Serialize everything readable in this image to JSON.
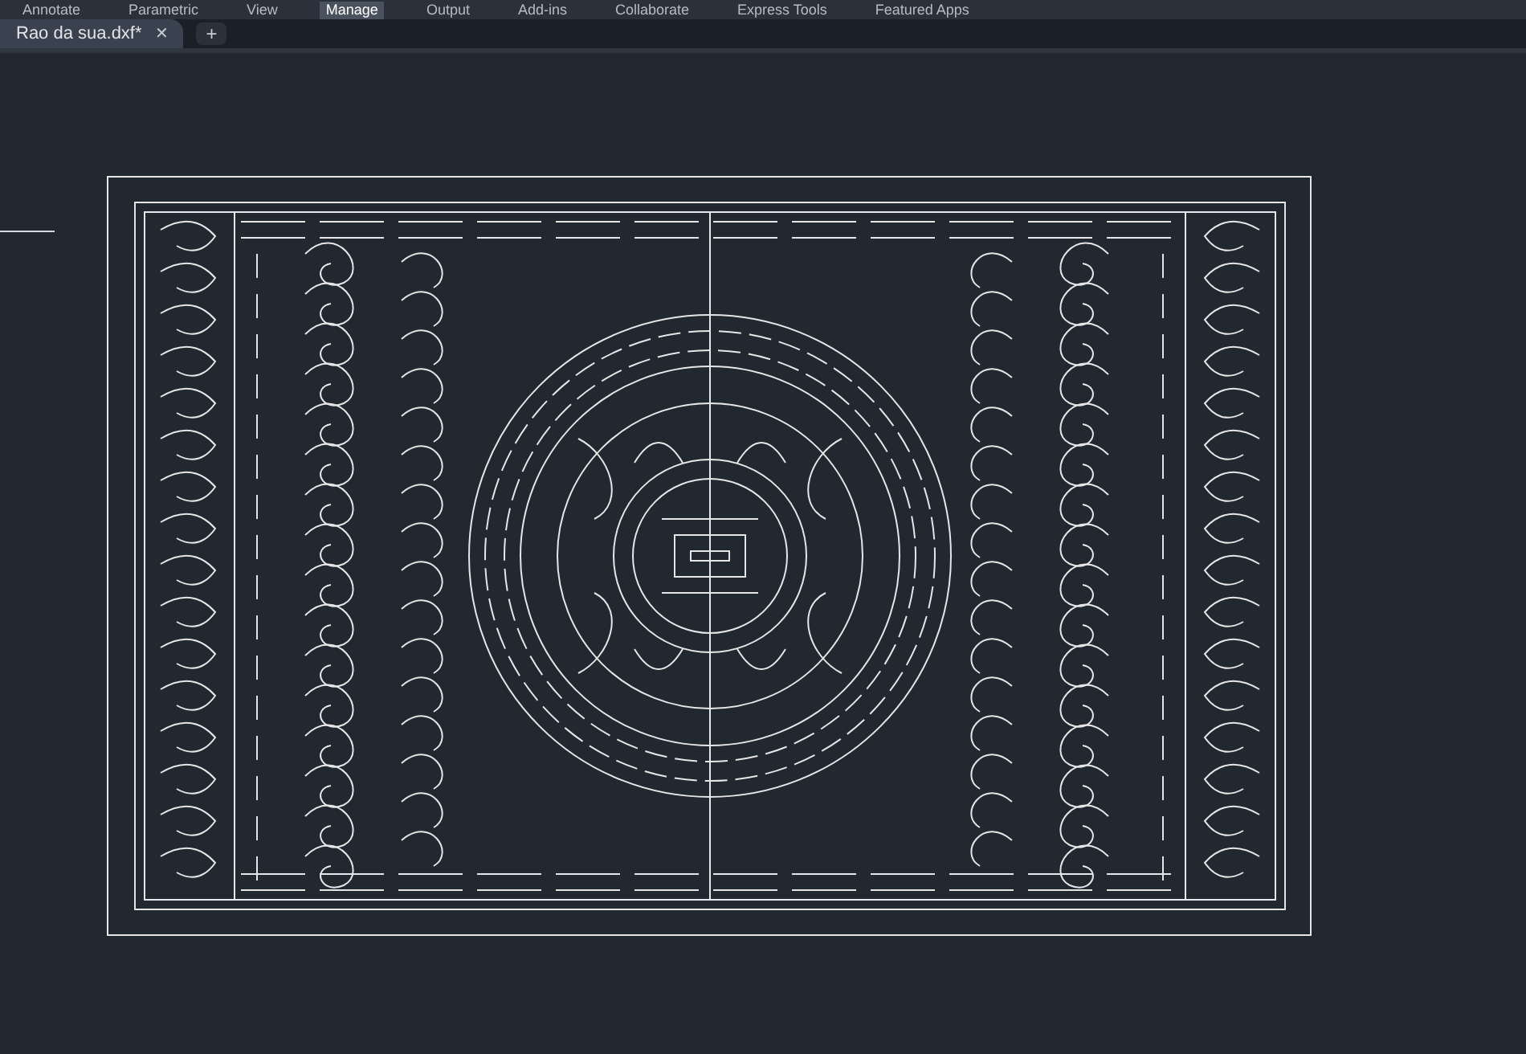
{
  "ribbon_tabs": [
    {
      "label": "Annotate",
      "selected": false
    },
    {
      "label": "Parametric",
      "selected": false
    },
    {
      "label": "View",
      "selected": false
    },
    {
      "label": "Manage",
      "selected": true
    },
    {
      "label": "Output",
      "selected": false
    },
    {
      "label": "Add-ins",
      "selected": false
    },
    {
      "label": "Collaborate",
      "selected": false
    },
    {
      "label": "Express Tools",
      "selected": false
    },
    {
      "label": "Featured Apps",
      "selected": false
    }
  ],
  "document_tabs": [
    {
      "label": "Rao da sua.dxf*",
      "close": "✕",
      "selected": true
    }
  ],
  "new_tab": "+"
}
